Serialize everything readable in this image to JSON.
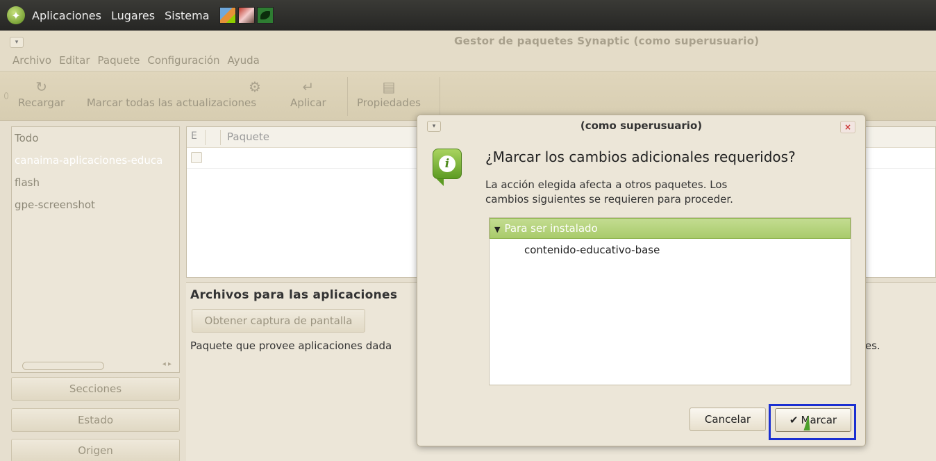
{
  "panel": {
    "menus": [
      "Aplicaciones",
      "Lugares",
      "Sistema"
    ]
  },
  "window": {
    "title": "Gestor de paquetes Synaptic (como superusuario)"
  },
  "menubar": [
    "Archivo",
    "Editar",
    "Paquete",
    "Configuración",
    "Ayuda"
  ],
  "toolbar": {
    "reload": "Recargar",
    "mark_all": "Marcar todas las actualizaciones",
    "apply": "Aplicar",
    "properties": "Propiedades"
  },
  "sidebar": {
    "items": [
      "Todo",
      "canaima-aplicaciones-educa",
      "flash",
      "gpe-screenshot"
    ],
    "buttons": [
      "Secciones",
      "Estado",
      "Origen"
    ]
  },
  "pkglist": {
    "col_e": "E",
    "col_package": "Paquete"
  },
  "desc": {
    "title": "Archivos para las aplicaciones",
    "screenshot_button": "Obtener captura de pantalla",
    "text": "Paquete que provee aplicaciones dada",
    "tail": "tes."
  },
  "dialog": {
    "title": "(como superusuario)",
    "question": "¿Marcar los cambios adicionales requeridos?",
    "message_line1": "La acción elegida afecta a otros paquetes. Los",
    "message_line2": "cambios siguientes se requieren para proceder.",
    "group": "Para ser instalado",
    "packages": [
      "contenido-educativo-base"
    ],
    "cancel": "Cancelar",
    "mark": "Marcar"
  }
}
